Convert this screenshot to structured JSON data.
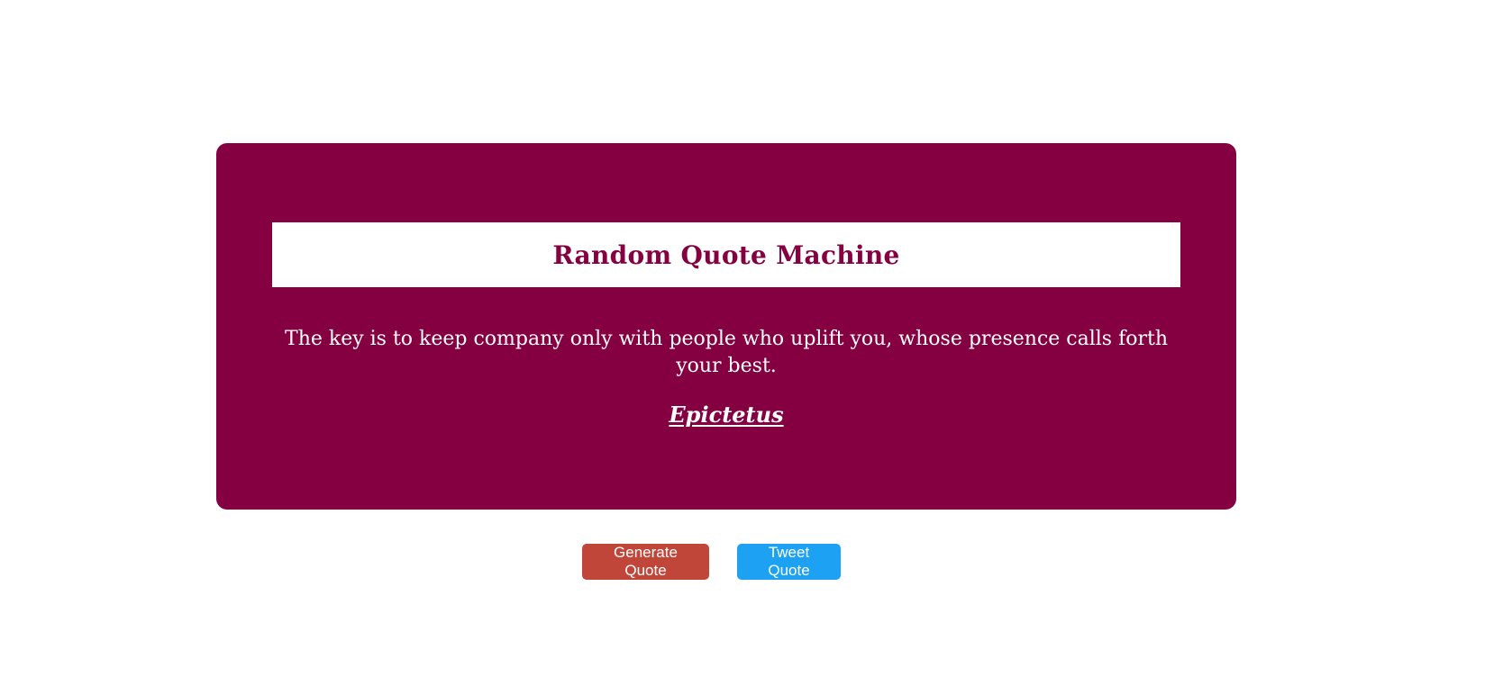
{
  "header": {
    "title": "Random Quote Machine"
  },
  "quote": {
    "text": "The key is to keep company only with people who uplift you, whose presence calls forth your best.",
    "author": "Epictetus"
  },
  "actions": {
    "generate_label": "Generate Quote",
    "tweet_label": "Tweet Quote"
  },
  "colors": {
    "card_background": "#850041",
    "title_text": "#850041",
    "generate_button": "#c0463a",
    "tweet_button": "#1da1f2"
  }
}
